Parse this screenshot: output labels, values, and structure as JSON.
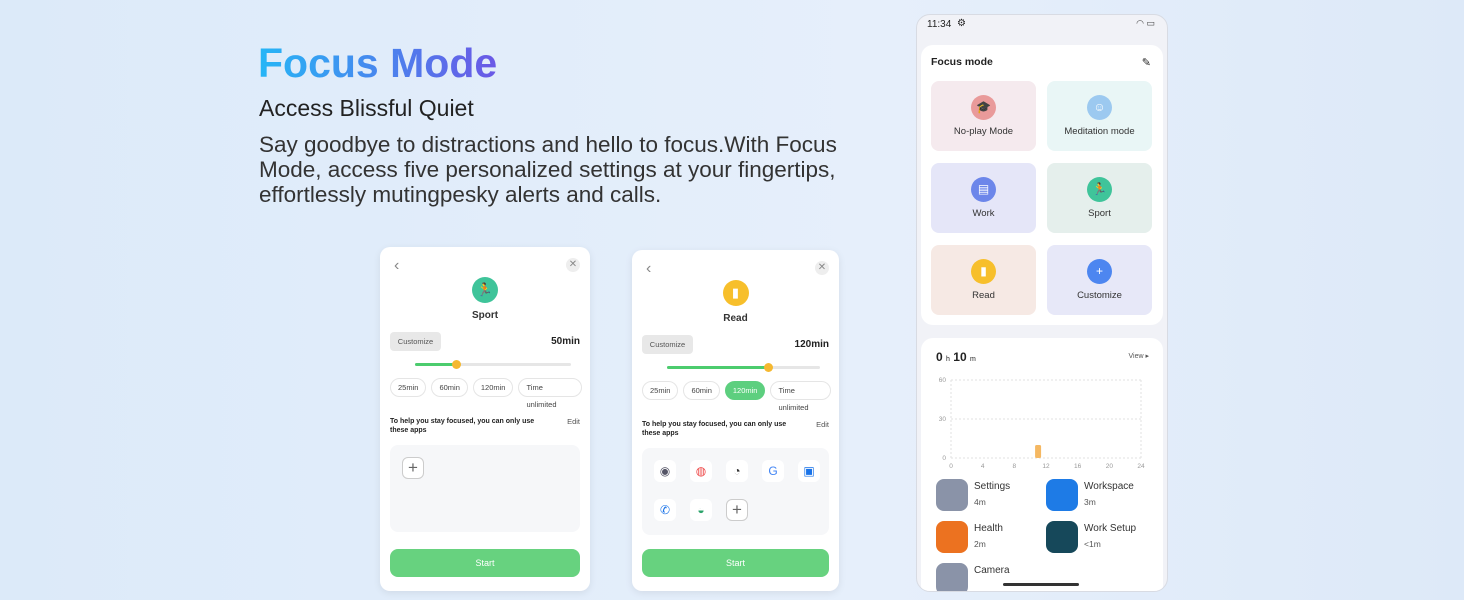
{
  "hero": {
    "title": "Focus Mode",
    "subtitle": "Access Blissful Quiet",
    "description": "Say goodbye to distractions and hello to focus.With Focus Mode, access five personalized settings at your fingertips, effortlessly mutingpesky alerts and calls."
  },
  "sport_card": {
    "back": "‹",
    "close": "✕",
    "icon": "running-person-icon",
    "icon_color": "#3fc49a",
    "name": "Sport",
    "customize": "Customize",
    "duration": "50min",
    "slider_percent": 26,
    "chips": [
      "25min",
      "60min",
      "120min",
      "Time unlimited"
    ],
    "selected_chip": null,
    "hint": "To help you stay focused, you can only use these apps",
    "edit": "Edit",
    "start": "Start"
  },
  "read_card": {
    "back": "‹",
    "close": "✕",
    "icon": "book-icon",
    "icon_color": "#f7bf2b",
    "name": "Read",
    "customize": "Customize",
    "duration": "120min",
    "slider_percent": 66,
    "chips": [
      "25min",
      "60min",
      "120min",
      "Time unlimited"
    ],
    "selected_chip": "120min",
    "hint": "To help you stay focused, you can only use these apps",
    "edit": "Edit",
    "start": "Start",
    "apps": [
      {
        "icon": "camera-icon",
        "glyph": "◉",
        "color": "#556"
      },
      {
        "icon": "chrome-icon",
        "glyph": "◍",
        "color": "#e44"
      },
      {
        "icon": "clock-icon",
        "glyph": "◔",
        "color": "#333"
      },
      {
        "icon": "google-icon",
        "glyph": "G",
        "color": "#4285f4"
      },
      {
        "icon": "calendar-icon",
        "glyph": "▣",
        "color": "#1a73e8"
      },
      {
        "icon": "phone-icon",
        "glyph": "✆",
        "color": "#1a73e8"
      },
      {
        "icon": "messages-icon",
        "glyph": "◒",
        "color": "#2ba36a"
      }
    ]
  },
  "phone": {
    "status": {
      "time": "11:34",
      "icons": [
        "gear-icon",
        "wifi-icon",
        "battery-icon"
      ]
    },
    "focus": {
      "title": "Focus mode",
      "edit_icon": "pencil-icon",
      "modes": [
        {
          "label": "No-play Mode",
          "icon": "graduation-cap-icon",
          "glyph": "🎓",
          "color": "#e99a9a",
          "bg": "#f5eaee"
        },
        {
          "label": "Meditation mode",
          "icon": "meditation-icon",
          "glyph": "☺",
          "color": "#9cc9f0",
          "bg": "#e9f6f6"
        },
        {
          "label": "Work",
          "icon": "briefcase-icon",
          "glyph": "▤",
          "color": "#6c86ea",
          "bg": "#e5e6f8"
        },
        {
          "label": "Sport",
          "icon": "running-person-icon",
          "glyph": "🏃",
          "color": "#3fc49a",
          "bg": "#e5efec"
        },
        {
          "label": "Read",
          "icon": "book-icon",
          "glyph": "▮",
          "color": "#f7bf2b",
          "bg": "#f6e9e4"
        },
        {
          "label": "Customize",
          "icon": "plus-icon",
          "glyph": "+",
          "color": "#4d86f0",
          "bg": "#e7e8f8"
        }
      ]
    },
    "usage": {
      "hours": "0",
      "h": "h",
      "minutes": "10",
      "m": "m",
      "view": "View ▸",
      "chart_data": {
        "type": "bar",
        "x": [
          11
        ],
        "values": [
          10
        ],
        "ylim": [
          0,
          60
        ],
        "yticks": [
          "0",
          "30",
          "60"
        ],
        "xticks": [
          "0",
          "4",
          "8",
          "12",
          "16",
          "20",
          "24"
        ],
        "xlim": [
          0,
          24
        ],
        "grid": true,
        "color": "#f5b862"
      },
      "apps": [
        {
          "name": "Settings",
          "time": "4m",
          "icon": "settings-icon",
          "color": "#8a93a8"
        },
        {
          "name": "Workspace",
          "time": "3m",
          "icon": "workspace-icon",
          "color": "#1e7be6"
        },
        {
          "name": "Health",
          "time": "2m",
          "icon": "health-icon",
          "color": "#ec7220"
        },
        {
          "name": "Work Setup",
          "time": "<1m",
          "icon": "android-icon",
          "color": "#16485a"
        },
        {
          "name": "Camera",
          "time": "",
          "icon": "camera-icon",
          "color": "#8a93a8"
        }
      ]
    }
  }
}
